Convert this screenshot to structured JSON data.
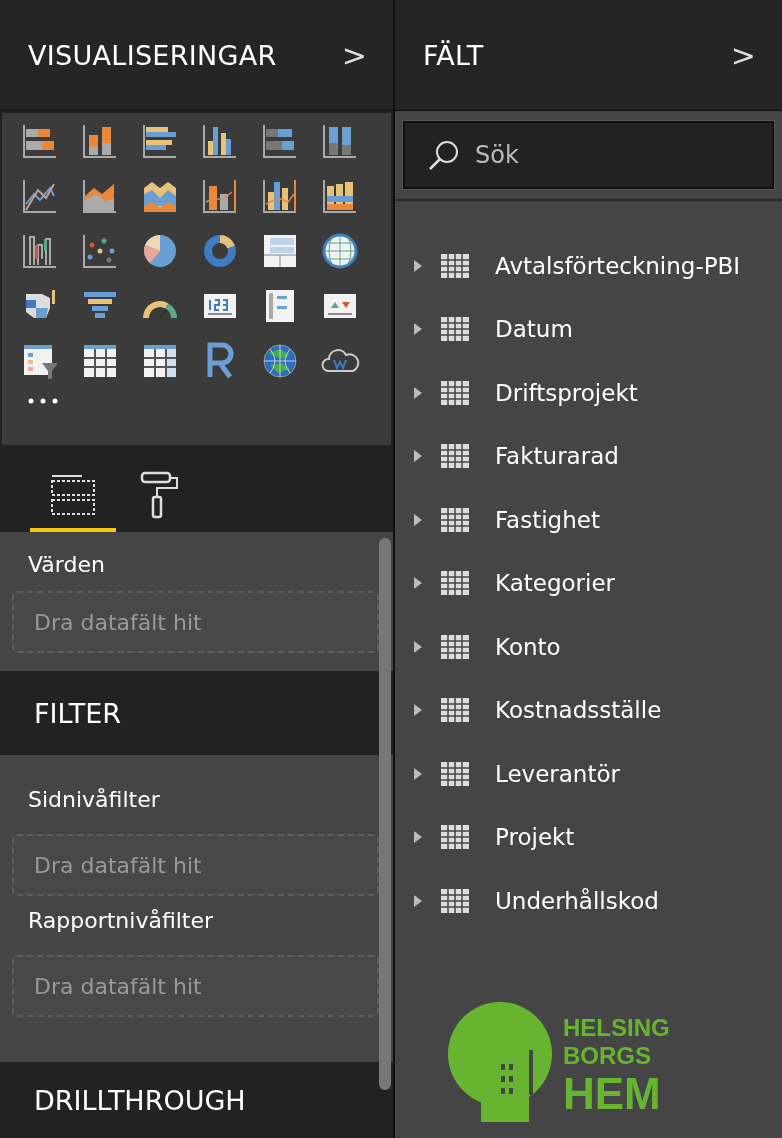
{
  "visualizations": {
    "title": "VISUALISERINGAR",
    "chevron": ">"
  },
  "build_tabs": [
    {
      "kind": "fields",
      "selected": true
    },
    {
      "kind": "format",
      "selected": false
    }
  ],
  "values_well": {
    "label": "Värden",
    "placeholder": "Dra datafält hit"
  },
  "filter": {
    "title": "FILTER",
    "wells": [
      {
        "label": "Sidnivåfilter",
        "placeholder": "Dra datafält hit"
      },
      {
        "label": "Rapportnivåfilter",
        "placeholder": "Dra datafält hit"
      }
    ]
  },
  "drillthrough": {
    "title": "DRILLTHROUGH"
  },
  "fields": {
    "title": "FÄLT",
    "chevron": ">",
    "search": {
      "placeholder": "Sök"
    },
    "tables": [
      {
        "name": "Avtalsförteckning-PBI",
        "expanded": false
      },
      {
        "name": "Datum",
        "expanded": false
      },
      {
        "name": "Driftsprojekt",
        "expanded": false
      },
      {
        "name": "Fakturarad",
        "expanded": false
      },
      {
        "name": "Fastighet",
        "expanded": false
      },
      {
        "name": "Kategorier",
        "expanded": false
      },
      {
        "name": "Konto",
        "expanded": false
      },
      {
        "name": "Kostnadsställe",
        "expanded": false
      },
      {
        "name": "Leverantör",
        "expanded": false
      },
      {
        "name": "Projekt",
        "expanded": false
      },
      {
        "name": "Underhållskod",
        "expanded": false
      }
    ]
  },
  "logo": {
    "lines": [
      "HELSING",
      "BORGS",
      "HEM"
    ]
  }
}
